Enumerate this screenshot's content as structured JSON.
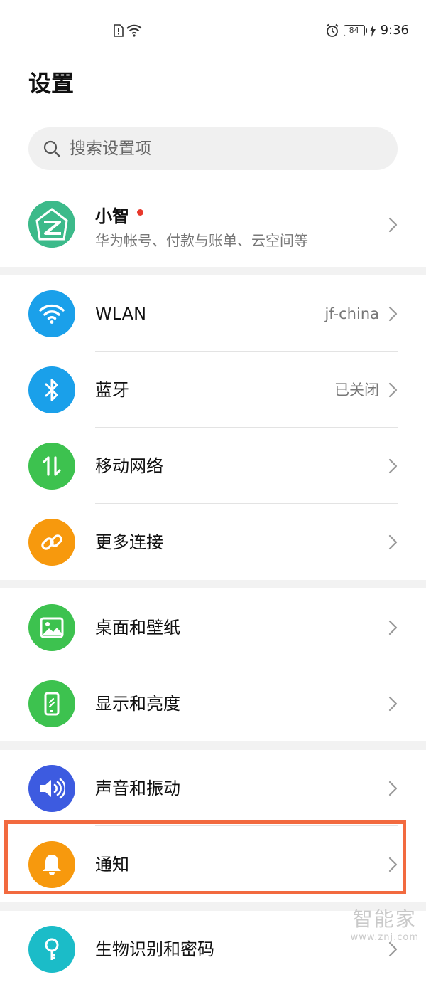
{
  "status_bar": {
    "time": "9:36",
    "battery": "84"
  },
  "page": {
    "title": "设置"
  },
  "search": {
    "placeholder": "搜索设置项"
  },
  "account": {
    "name": "小智",
    "subtitle": "华为帐号、付款与账单、云空间等"
  },
  "groups": {
    "network": {
      "wlan": {
        "label": "WLAN",
        "value": "jf-china"
      },
      "bluetooth": {
        "label": "蓝牙",
        "value": "已关闭"
      },
      "mobile": {
        "label": "移动网络"
      },
      "more": {
        "label": "更多连接"
      }
    },
    "display": {
      "wallpaper": {
        "label": "桌面和壁纸"
      },
      "brightness": {
        "label": "显示和亮度"
      }
    },
    "sound": {
      "sound": {
        "label": "声音和振动"
      },
      "notify": {
        "label": "通知"
      },
      "biometric": {
        "label": "生物识别和密码"
      }
    }
  },
  "colors": {
    "blue": "#1aa0ea",
    "green": "#3dc24f",
    "orange": "#f7990d",
    "indigo": "#3d5be0",
    "teal": "#1bbcc8",
    "highlight": "#f26a3f"
  },
  "watermark": {
    "logo": "智能家",
    "url": "www.znj.com"
  }
}
